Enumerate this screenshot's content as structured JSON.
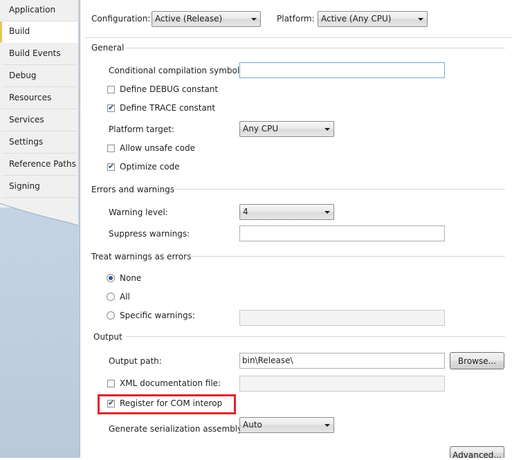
{
  "sidebar": {
    "items": [
      {
        "label": "Application"
      },
      {
        "label": "Build"
      },
      {
        "label": "Build Events"
      },
      {
        "label": "Debug"
      },
      {
        "label": "Resources"
      },
      {
        "label": "Services"
      },
      {
        "label": "Settings"
      },
      {
        "label": "Reference Paths"
      },
      {
        "label": "Signing"
      }
    ],
    "selected": "Build"
  },
  "top": {
    "configuration_label": "Configuration:",
    "configuration_value": "Active (Release)",
    "platform_label": "Platform:",
    "platform_value": "Active (Any CPU)"
  },
  "general": {
    "title": "General",
    "cond_symbols_label": "Conditional compilation symbols:",
    "cond_symbols_value": "",
    "define_debug_label": "Define DEBUG constant",
    "define_debug_checked": false,
    "define_trace_label": "Define TRACE constant",
    "define_trace_checked": true,
    "platform_target_label": "Platform target:",
    "platform_target_value": "Any CPU",
    "allow_unsafe_label": "Allow unsafe code",
    "allow_unsafe_checked": false,
    "optimize_label": "Optimize code",
    "optimize_checked": true
  },
  "errors": {
    "title": "Errors and warnings",
    "warning_level_label": "Warning level:",
    "warning_level_value": "4",
    "suppress_label": "Suppress warnings:",
    "suppress_value": ""
  },
  "treat": {
    "title": "Treat warnings as errors",
    "none_label": "None",
    "all_label": "All",
    "specific_label": "Specific warnings:",
    "selected": "None",
    "specific_value": ""
  },
  "output": {
    "title": "Output",
    "path_label": "Output path:",
    "path_value": "bin\\Release\\",
    "browse_label": "Browse...",
    "xml_doc_label": "XML documentation file:",
    "xml_doc_checked": false,
    "xml_doc_value": "",
    "com_interop_label": "Register for COM interop",
    "com_interop_checked": true,
    "serialization_label": "Generate serialization assembly:",
    "serialization_value": "Auto",
    "advanced_label": "Advanced..."
  },
  "colors": {
    "highlight": "#e8202a",
    "sidebar_bg": "#bccbdc",
    "selected_tab_accent": "#e2c85c"
  },
  "icons": [
    "checkmark-icon",
    "dropdown-arrow-icon",
    "radio-dot-icon"
  ]
}
